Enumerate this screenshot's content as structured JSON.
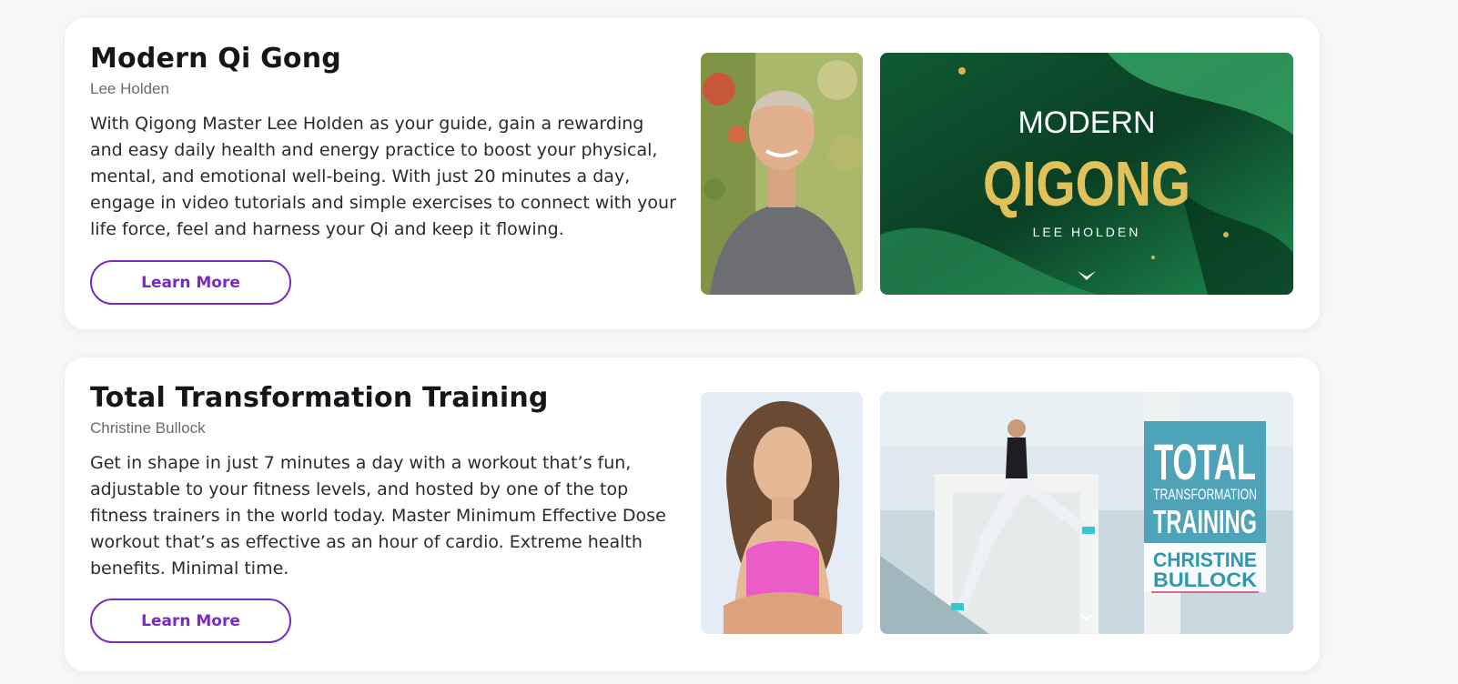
{
  "courses": [
    {
      "title": "Modern Qi Gong",
      "author": "Lee Holden",
      "description": "With Qigong Master Lee Holden as your guide, gain a rewarding and easy daily health and energy practice to boost your physical, mental, and emotional well-being. With just 20 minutes a day, engage in video tutorials and simple exercises to connect with your life force, feel and harness your Qi and keep it flowing.",
      "button_label": "Learn More",
      "cover": {
        "line1": "MODERN",
        "line2": "QIGONG",
        "author": "LEE HOLDEN"
      }
    },
    {
      "title": "Total Transformation Training",
      "author": "Christine Bullock",
      "description": "Get in shape in just 7 minutes a day with a workout that’s fun, adjustable to your fitness levels, and hosted by one of the top fitness trainers in the world today. Master Minimum Effective Dose workout that’s as effective as an hour of cardio. Extreme health benefits. Minimal time.",
      "button_label": "Learn More",
      "cover": {
        "line1": "TOTAL",
        "line2": "TRANSFORMATION",
        "line3": "TRAINING",
        "author1": "CHRISTINE",
        "author2": "BULLOCK"
      }
    }
  ],
  "colors": {
    "accent": "#7b28c8",
    "qigong_gold": "#e0c15a",
    "ttt_teal": "#4fa3b8"
  }
}
